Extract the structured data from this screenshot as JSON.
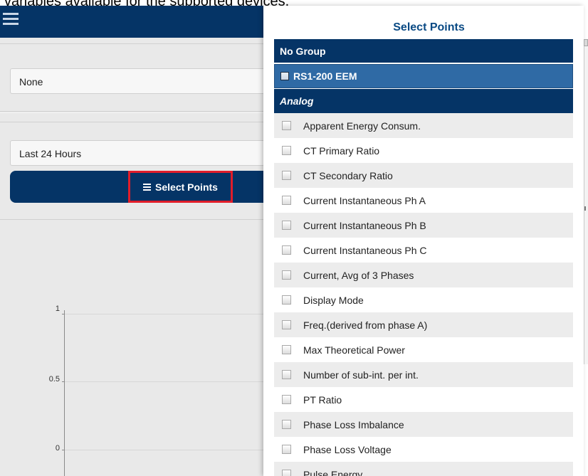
{
  "caption": "variables available for the supported devices.",
  "app": {
    "filter_value": "None",
    "range_value": "Last 24 Hours",
    "select_points_label": "Select Points"
  },
  "chart": {
    "y_ticks": [
      "1",
      "0.5",
      "0"
    ]
  },
  "panel": {
    "title": "Select Points",
    "group_label": "No Group",
    "device_label": "RS1-200 EEM",
    "section_label": "Analog",
    "points": [
      "Apparent Energy Consum.",
      "CT Primary Ratio",
      "CT Secondary Ratio",
      "Current Instantaneous Ph A",
      "Current Instantaneous Ph B",
      "Current Instantaneous Ph C",
      "Current, Avg of 3 Phases",
      "Display Mode",
      "Freq.(derived from phase A)",
      "Max Theoretical Power",
      "Number of sub-int. per int.",
      "PT Ratio",
      "Phase Loss Imbalance",
      "Phase Loss Voltage",
      "Pulse Energy"
    ]
  },
  "colors": {
    "header_navy": "#053466",
    "device_blue": "#2f6aa5",
    "highlight_red": "#e11d2a",
    "title_blue": "#0a4a84"
  }
}
